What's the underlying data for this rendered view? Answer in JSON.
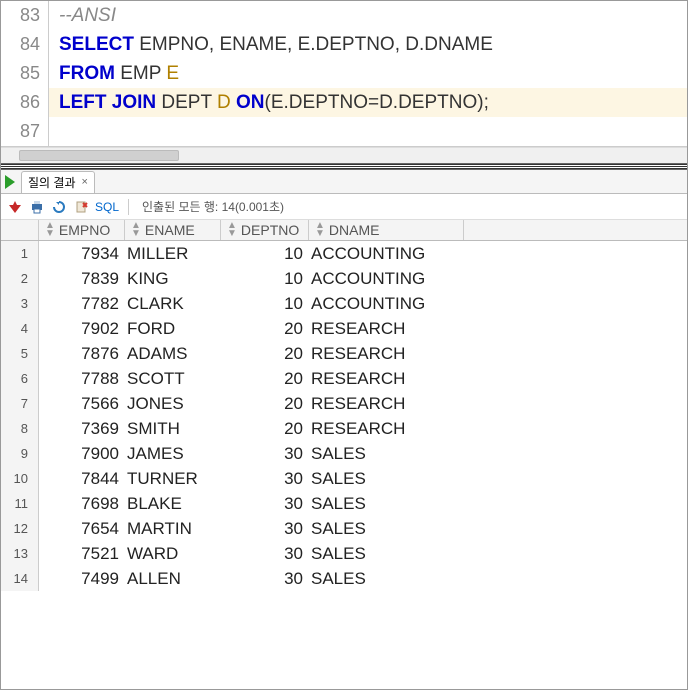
{
  "editor": {
    "lines": [
      {
        "num": "83",
        "segments": [
          {
            "cls": "cm",
            "t": "--ANSI"
          }
        ]
      },
      {
        "num": "84",
        "segments": [
          {
            "cls": "kw",
            "t": "SELECT "
          },
          {
            "cls": "norm",
            "t": "EMPNO, ENAME, E.DEPTNO, D.DNAME"
          }
        ]
      },
      {
        "num": "85",
        "segments": [
          {
            "cls": "kw",
            "t": "FROM "
          },
          {
            "cls": "norm",
            "t": "EMP "
          },
          {
            "cls": "alias",
            "t": "E"
          }
        ]
      },
      {
        "num": "86",
        "highlight": true,
        "segments": [
          {
            "cls": "kw",
            "t": "LEFT JOIN "
          },
          {
            "cls": "norm",
            "t": "DEPT "
          },
          {
            "cls": "alias",
            "t": "D "
          },
          {
            "cls": "kw",
            "t": "ON"
          },
          {
            "cls": "norm",
            "t": "(E.DEPTNO=D.DEPTNO);"
          }
        ]
      },
      {
        "num": "87",
        "segments": []
      }
    ]
  },
  "tab": {
    "label": "질의 결과"
  },
  "toolbar": {
    "sql_label": "SQL",
    "status": "인출된 모든 행: 14(0.001초)"
  },
  "columns": {
    "empno": "EMPNO",
    "ename": "ENAME",
    "deptno": "DEPTNO",
    "dname": "DNAME"
  },
  "rows": [
    {
      "n": "1",
      "empno": "7934",
      "ename": "MILLER",
      "deptno": "10",
      "dname": "ACCOUNTING"
    },
    {
      "n": "2",
      "empno": "7839",
      "ename": "KING",
      "deptno": "10",
      "dname": "ACCOUNTING"
    },
    {
      "n": "3",
      "empno": "7782",
      "ename": "CLARK",
      "deptno": "10",
      "dname": "ACCOUNTING"
    },
    {
      "n": "4",
      "empno": "7902",
      "ename": "FORD",
      "deptno": "20",
      "dname": "RESEARCH"
    },
    {
      "n": "5",
      "empno": "7876",
      "ename": "ADAMS",
      "deptno": "20",
      "dname": "RESEARCH"
    },
    {
      "n": "6",
      "empno": "7788",
      "ename": "SCOTT",
      "deptno": "20",
      "dname": "RESEARCH"
    },
    {
      "n": "7",
      "empno": "7566",
      "ename": "JONES",
      "deptno": "20",
      "dname": "RESEARCH"
    },
    {
      "n": "8",
      "empno": "7369",
      "ename": "SMITH",
      "deptno": "20",
      "dname": "RESEARCH"
    },
    {
      "n": "9",
      "empno": "7900",
      "ename": "JAMES",
      "deptno": "30",
      "dname": "SALES"
    },
    {
      "n": "10",
      "empno": "7844",
      "ename": "TURNER",
      "deptno": "30",
      "dname": "SALES"
    },
    {
      "n": "11",
      "empno": "7698",
      "ename": "BLAKE",
      "deptno": "30",
      "dname": "SALES"
    },
    {
      "n": "12",
      "empno": "7654",
      "ename": "MARTIN",
      "deptno": "30",
      "dname": "SALES"
    },
    {
      "n": "13",
      "empno": "7521",
      "ename": "WARD",
      "deptno": "30",
      "dname": "SALES"
    },
    {
      "n": "14",
      "empno": "7499",
      "ename": "ALLEN",
      "deptno": "30",
      "dname": "SALES"
    }
  ]
}
